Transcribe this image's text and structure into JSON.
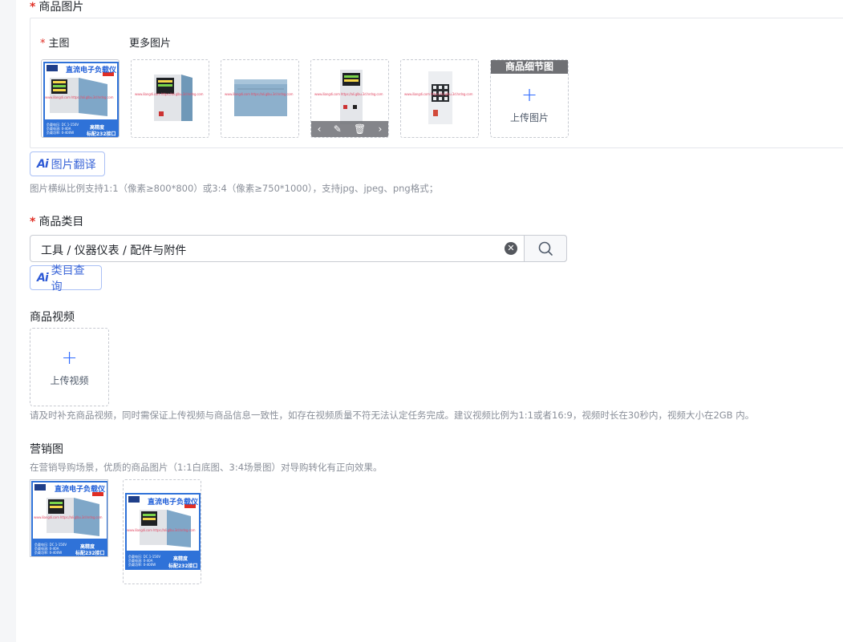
{
  "images_section": {
    "title": "商品图片",
    "main_label": "主图",
    "more_label": "更多图片",
    "banner_title": "直流电子负载仪",
    "banner_badge_top": "高精度",
    "banner_badge_bottom": "标配232接口",
    "spec_lines": [
      "负载电压: DC 1-150V",
      "负载电流: 0-40A",
      "负载功率: 0-400W"
    ],
    "watermark": "www.iliangdi.com  https://ali.glbu.3d.hrdng.com",
    "detail_label": "商品细节图",
    "upload_text": "上传图片",
    "ai_translate": "图片翻译",
    "hint": "图片横纵比例支持1:1（像素≥800*800）或3:4（像素≥750*1000），支持jpg、jpeg、png格式；"
  },
  "category_section": {
    "title": "商品类目",
    "value": "工具 / 仪器仪表 / 配件与附件",
    "ai_query": "类目查询"
  },
  "video_section": {
    "title": "商品视频",
    "upload_text": "上传视频",
    "hint": "请及时补充商品视频，同时需保证上传视频与商品信息一致性，如存在视频质量不符无法认定任务完成。建议视频比例为1:1或者16:9，视频时长在30秒内，视频大小在2GB 内。"
  },
  "marketing_section": {
    "title": "营销图",
    "hint": "在营销导购场景，优质的商品图片（1:1白底图、3:4场景图）对导购转化有正向效果。"
  },
  "icons": [
    "plus-icon",
    "clear-icon",
    "search-icon",
    "chevron-left-icon",
    "edit-icon",
    "trash-icon",
    "chevron-right-icon"
  ],
  "colors": {
    "accent": "#2f6bff",
    "required": "#e02e24",
    "hint": "#8a8f99"
  }
}
